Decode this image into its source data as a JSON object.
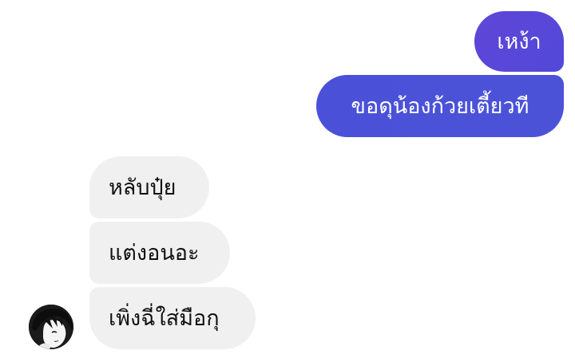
{
  "messages": {
    "outgoing": [
      {
        "text": "เหง้า"
      },
      {
        "text": "ขอดุน้องก้วยเตี้ยวที"
      }
    ],
    "incoming": [
      {
        "text": "หลับปุ๋ย"
      },
      {
        "text": "แต่งอนอะ"
      },
      {
        "text": "เพิ่งฉี่ใส่มือกุ"
      }
    ]
  },
  "colors": {
    "outgoing_bubble": "#4f4fd8",
    "incoming_bubble": "#f0f0f0",
    "background": "#ffffff"
  },
  "avatar": {
    "icon": "user-avatar-portrait"
  }
}
